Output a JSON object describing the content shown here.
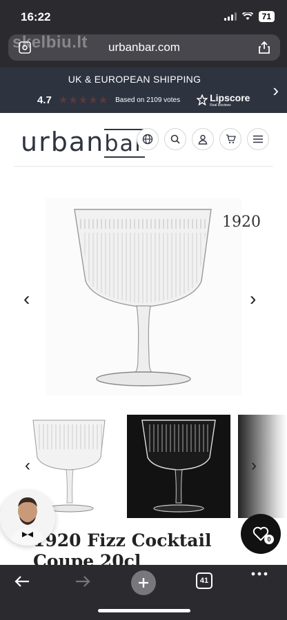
{
  "status": {
    "time": "16:22",
    "battery": "71"
  },
  "browser": {
    "url": "urbanbar.com",
    "watermark": "skelbiu.lt",
    "tab_count": "41"
  },
  "banner": {
    "title": "UK & EUROPEAN SHIPPING",
    "rating": "4.7",
    "stars": "★★★★★",
    "votes": "Based on 2109 votes",
    "brand": "Lipscore",
    "brand_sub": "Real Reviews"
  },
  "header": {
    "logo_part1": "urban",
    "logo_part2": "bar"
  },
  "product": {
    "badge": "1920",
    "title": "1920 Fizz Cocktail Coupe 20cl"
  },
  "wishlist": {
    "count": "0"
  },
  "colors": {
    "dark_chrome": "#2b2b2f",
    "banner_bg": "#2e3340",
    "brand": "#2f3440"
  }
}
